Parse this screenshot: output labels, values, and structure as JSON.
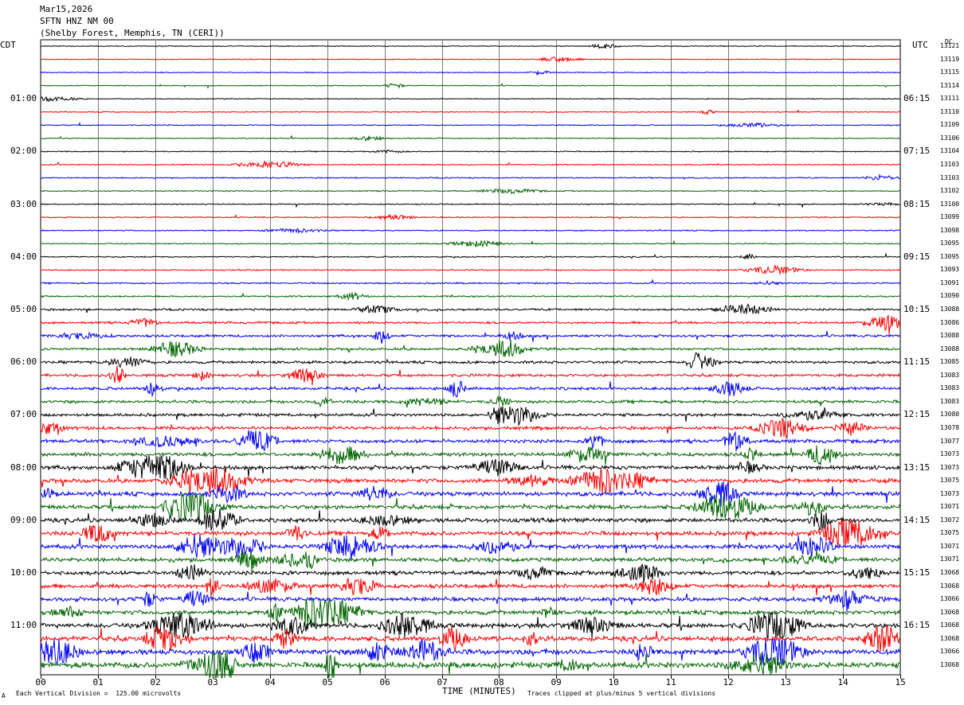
{
  "header": {
    "date": "Mar15,2026",
    "station": "SFTN HNZ NM 00",
    "location": "(Shelby Forest, Memphis, TN (CERI))"
  },
  "left_timezone": "CDT",
  "right_timezone": "UTC",
  "dc_label": "DC",
  "footer": {
    "scale_note": "Each Vertical Division =  125.00 microvolts",
    "clip_note": "Traces clipped at plus/minus 5 vertical divisions",
    "corner_mark": "A"
  },
  "chart_data": {
    "type": "seismogram",
    "title": "SFTN HNZ NM 00",
    "xlabel": "TIME (MINUTES)",
    "xlim": [
      0,
      15
    ],
    "x_ticks": [
      "00",
      "01",
      "02",
      "03",
      "04",
      "05",
      "06",
      "07",
      "08",
      "09",
      "10",
      "11",
      "12",
      "13",
      "14",
      "15"
    ],
    "trace_colors": [
      "#000000",
      "#ff0000",
      "#0000ff",
      "#006400"
    ],
    "cdt_hour_labels": [
      "01:00",
      "02:00",
      "03:00",
      "04:00",
      "05:00",
      "06:00",
      "07:00",
      "08:00",
      "09:00",
      "10:00",
      "11:00"
    ],
    "utc_hour_labels": [
      "06:15",
      "07:15",
      "08:15",
      "09:15",
      "10:15",
      "11:15",
      "12:15",
      "13:15",
      "14:15",
      "15:15",
      "16:15"
    ],
    "dc_offsets": [
      "13121",
      "13119",
      "13115",
      "13114",
      "13111",
      "13110",
      "13109",
      "13106",
      "13104",
      "13103",
      "13103",
      "13102",
      "13100",
      "13099",
      "13098",
      "13095",
      "13095",
      "13093",
      "13091",
      "13090",
      "13088",
      "13086",
      "13088",
      "13088",
      "13085",
      "13083",
      "13083",
      "13083",
      "13080",
      "13078",
      "13077",
      "13073",
      "13073",
      "13075",
      "13073",
      "13071",
      "13072",
      "13075",
      "13071",
      "13071",
      "13068",
      "13068",
      "13066",
      "13068",
      "13068",
      "13068",
      "13066",
      "13068"
    ],
    "trace_activity": [
      0.35,
      0.35,
      0.35,
      0.35,
      0.35,
      0.4,
      0.4,
      0.4,
      0.4,
      0.45,
      0.45,
      0.45,
      0.45,
      0.45,
      0.45,
      0.45,
      0.5,
      0.5,
      0.6,
      0.6,
      0.8,
      0.9,
      1.0,
      1.0,
      1.1,
      1.1,
      1.2,
      1.2,
      1.2,
      1.3,
      1.4,
      1.5,
      1.6,
      1.7,
      1.7,
      1.7,
      1.7,
      1.7,
      1.7,
      1.6,
      1.6,
      1.6,
      1.6,
      1.7,
      1.9,
      2.0,
      2.1,
      2.2
    ]
  }
}
